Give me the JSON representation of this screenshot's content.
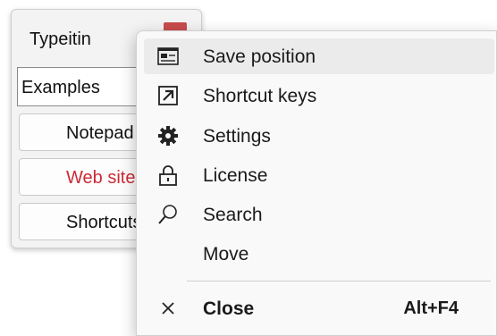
{
  "window": {
    "title": "Typeitin",
    "combo_value": "Examples",
    "buttons": [
      {
        "label": "Notepad",
        "color": "#111111"
      },
      {
        "label": "Web site",
        "color": "#cc2a36"
      },
      {
        "label": "Shortcuts",
        "color": "#111111"
      }
    ]
  },
  "menu": {
    "items": [
      {
        "label": "Save position",
        "icon": "window-layout-icon",
        "hover": true
      },
      {
        "label": "Shortcut keys",
        "icon": "shortcut-arrow-icon"
      },
      {
        "label": "Settings",
        "icon": "gear-icon"
      },
      {
        "label": "License",
        "icon": "padlock-icon"
      },
      {
        "label": "Search",
        "icon": "magnifier-icon"
      },
      {
        "label": "Move",
        "icon": ""
      },
      {
        "label": "Close",
        "icon": "close-icon",
        "accelerator": "Alt+F4"
      }
    ]
  }
}
